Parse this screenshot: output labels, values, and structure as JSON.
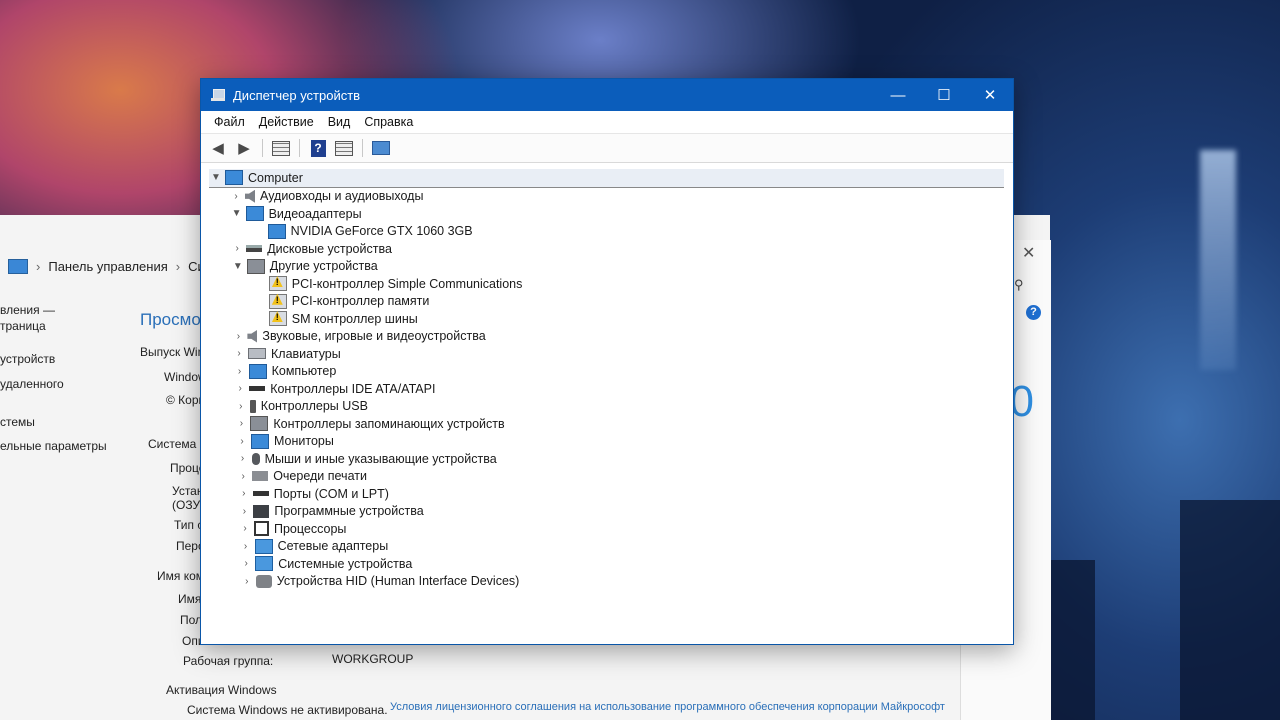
{
  "control_panel": {
    "breadcrumb": [
      "Панель управления",
      "Си"
    ],
    "left_items": [
      "вления —",
      "траница",
      "устройств",
      "удаленного",
      "стемы",
      "ельные параметры"
    ],
    "heading": "Просмотр",
    "lines": [
      "Выпуск Wind",
      "Windows",
      "© Корпо",
      "Система",
      "Процесс",
      "Установл",
      "(ОЗУ):",
      "Тип сист",
      "Перо и с",
      "Имя компь",
      "Имя ком",
      "Полное",
      "Описани",
      "Рабочая группа:",
      "Активация Windows",
      "Система Windows не активирована."
    ],
    "workgroup": "WORKGROUP",
    "license_link": "Условия лицензионного соглашения на использование программного обеспечения корпорации Майкрософт",
    "win10_fragment": "10"
  },
  "window": {
    "title": "Диспетчер устройств",
    "controls": {
      "minimize": "—",
      "maximize": "☐",
      "close": "✕"
    }
  },
  "menu": [
    "Файл",
    "Действие",
    "Вид",
    "Справка"
  ],
  "tree": {
    "root": "Computer",
    "categories": [
      {
        "label": "Аудиовходы и аудиовыходы",
        "expanded": false,
        "icon": "speaker-icon"
      },
      {
        "label": "Видеоадаптеры",
        "expanded": true,
        "icon": "display-adapter-icon",
        "children": [
          "NVIDIA GeForce GTX 1060 3GB"
        ]
      },
      {
        "label": "Дисковые устройства",
        "expanded": false,
        "icon": "disk-icon"
      },
      {
        "label": "Другие устройства",
        "expanded": true,
        "icon": "other-devices-icon",
        "children": [
          "PCI-контроллер Simple Communications",
          "PCI-контроллер памяти",
          "SM контроллер шины"
        ]
      },
      {
        "label": "Звуковые, игровые и видеоустройства",
        "expanded": false,
        "icon": "sound-icon"
      },
      {
        "label": "Клавиатуры",
        "expanded": false,
        "icon": "keyboard-icon"
      },
      {
        "label": "Компьютер",
        "expanded": false,
        "icon": "computer-icon"
      },
      {
        "label": "Контроллеры IDE ATA/ATAPI",
        "expanded": false,
        "icon": "ide-icon"
      },
      {
        "label": "Контроллеры USB",
        "expanded": false,
        "icon": "usb-icon"
      },
      {
        "label": "Контроллеры запоминающих устройств",
        "expanded": false,
        "icon": "storage-icon"
      },
      {
        "label": "Мониторы",
        "expanded": false,
        "icon": "monitor-icon"
      },
      {
        "label": "Мыши и иные указывающие устройства",
        "expanded": false,
        "icon": "mouse-icon"
      },
      {
        "label": "Очереди печати",
        "expanded": false,
        "icon": "printer-icon"
      },
      {
        "label": "Порты (COM и LPT)",
        "expanded": false,
        "icon": "port-icon"
      },
      {
        "label": "Программные устройства",
        "expanded": false,
        "icon": "software-device-icon"
      },
      {
        "label": "Процессоры",
        "expanded": false,
        "icon": "cpu-icon"
      },
      {
        "label": "Сетевые адаптеры",
        "expanded": false,
        "icon": "network-icon"
      },
      {
        "label": "Системные устройства",
        "expanded": false,
        "icon": "system-icon"
      },
      {
        "label": "Устройства HID (Human Interface Devices)",
        "expanded": false,
        "icon": "hid-icon"
      }
    ]
  }
}
